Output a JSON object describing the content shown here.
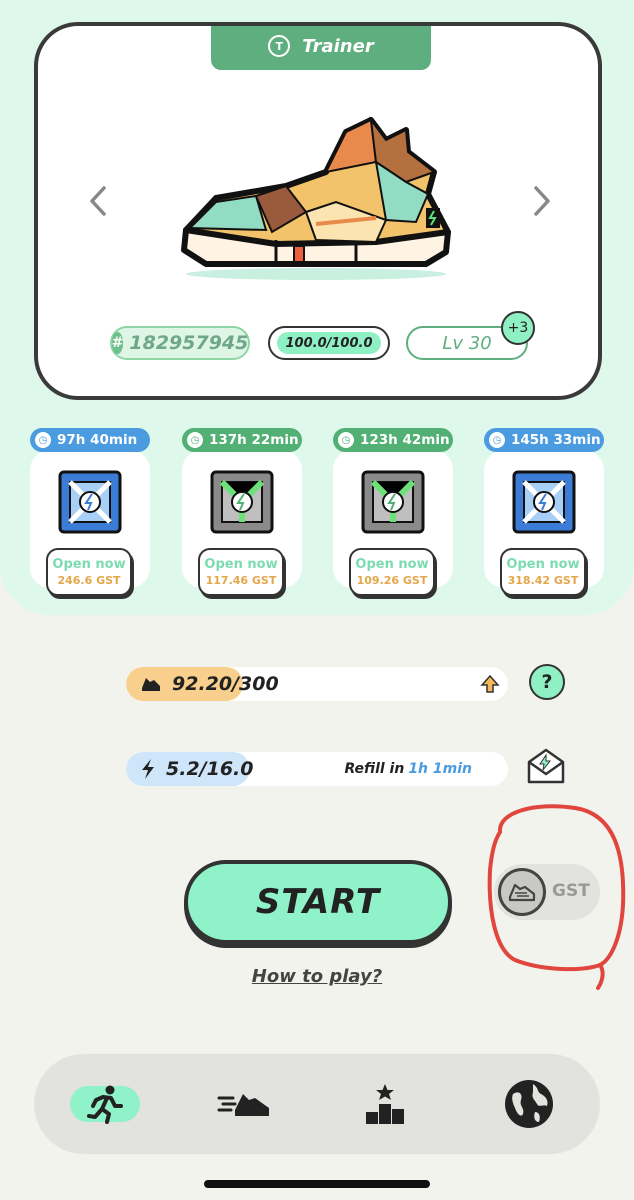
{
  "card": {
    "tab_label": "Trainer",
    "tab_icon": "T",
    "sneaker_id": "182957945",
    "durability": "100.0/100.0",
    "level": "Lv 30",
    "level_bonus": "+3"
  },
  "mystery_boxes": [
    {
      "timer": "97h 40min",
      "color": "blue",
      "open_label": "Open now",
      "gst": "246.6 GST"
    },
    {
      "timer": "137h 22min",
      "color": "green",
      "open_label": "Open now",
      "gst": "117.46 GST"
    },
    {
      "timer": "123h 42min",
      "color": "green",
      "open_label": "Open now",
      "gst": "109.26 GST"
    },
    {
      "timer": "145h 33min",
      "color": "blue",
      "open_label": "Open now",
      "gst": "318.42 GST"
    }
  ],
  "stats": {
    "gst_limit": "92.20/300",
    "gst_fill_fraction": 0.307,
    "energy": "5.2/16.0",
    "energy_fill_fraction": 0.325,
    "refill_label": "Refill in",
    "refill_time": "1h 1min",
    "help": "?"
  },
  "controls": {
    "start_label": "START",
    "how_to_play": "How to play?",
    "currency_toggle": "GST"
  },
  "nav": {
    "items": [
      "run",
      "sneakers",
      "ranking",
      "globe"
    ],
    "active": "run"
  },
  "colors": {
    "accent": "#8ff2c8",
    "card_tab": "#5fae7f",
    "timer_blue": "#4a9be0",
    "timer_green": "#52b074",
    "gst_orange": "#e4a64a",
    "annotation_red": "#e0463e"
  }
}
